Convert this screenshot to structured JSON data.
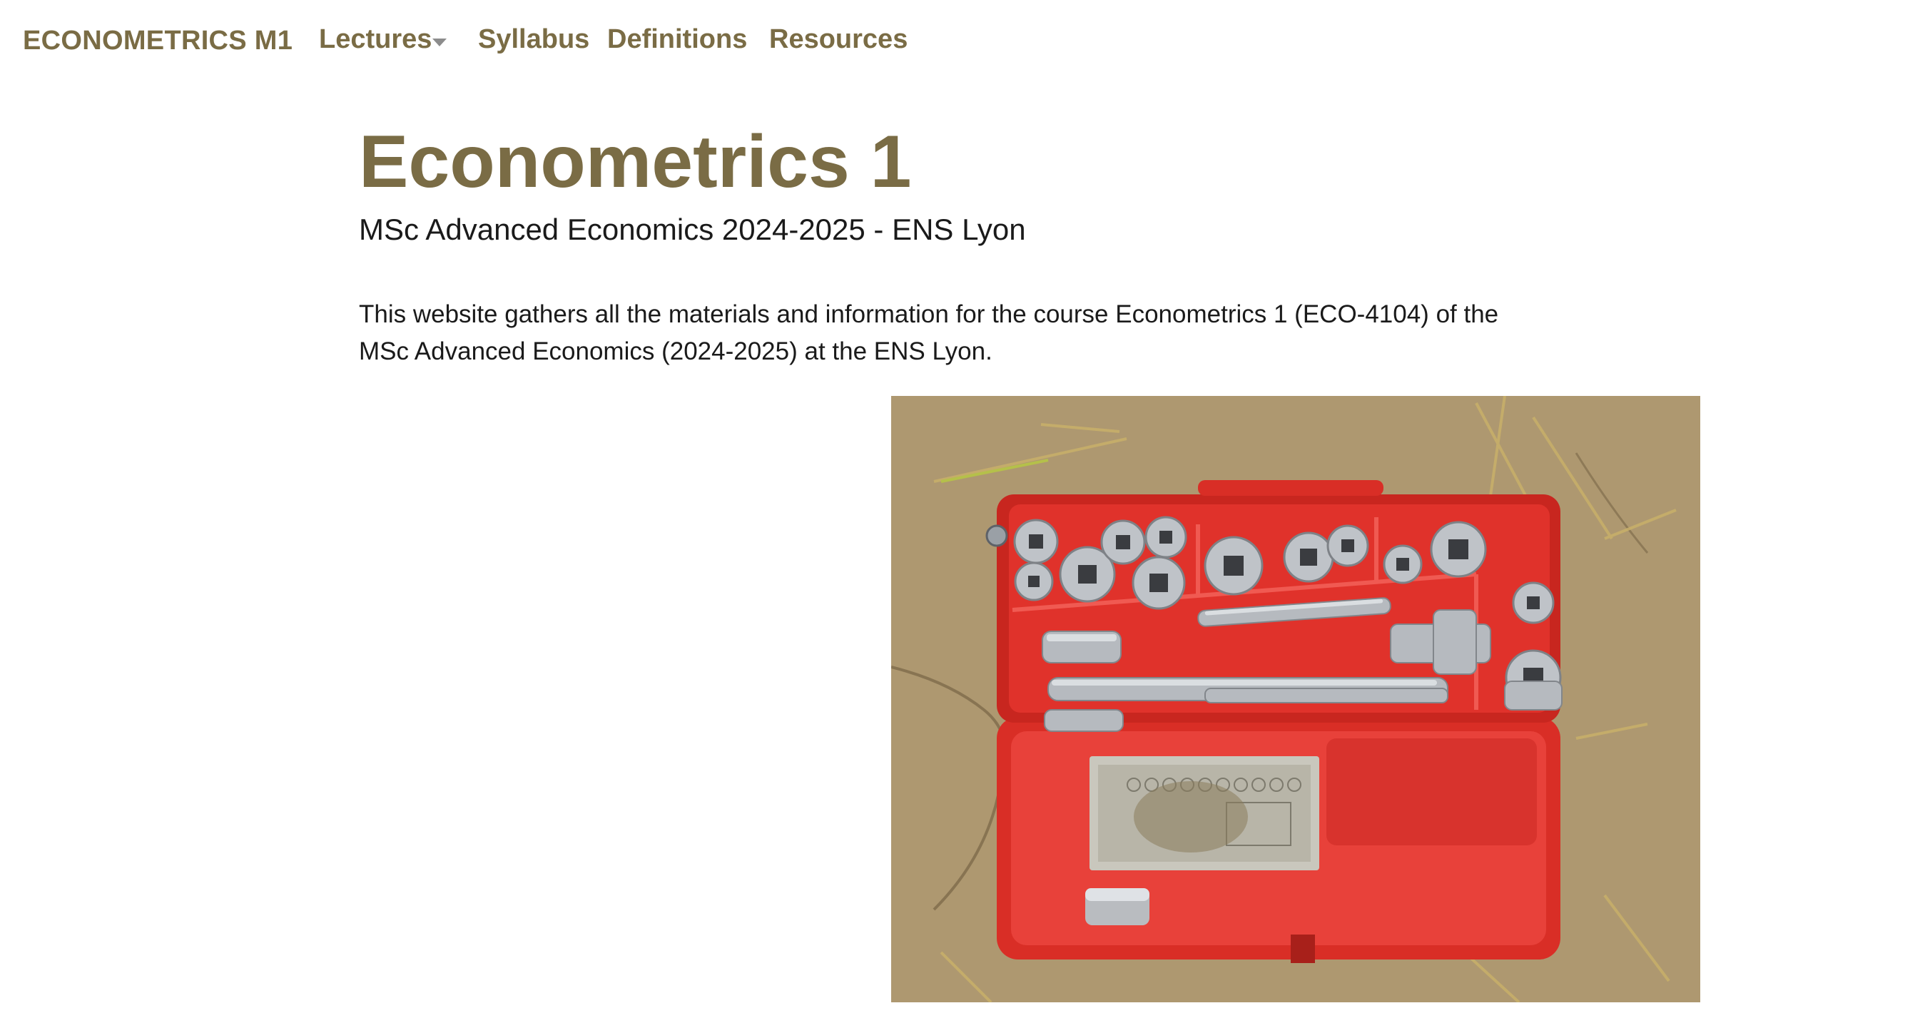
{
  "navbar": {
    "brand": "ECONOMETRICS M1",
    "items": [
      {
        "label": "Lectures",
        "has_dropdown": true
      },
      {
        "label": "Syllabus"
      },
      {
        "label": "Definitions"
      },
      {
        "label": "Resources"
      }
    ]
  },
  "main": {
    "title": "Econometrics 1",
    "subtitle": "MSc Advanced Economics 2024-2025 - ENS Lyon",
    "intro": "This website gathers all the materials and information for the course Econometrics 1 (ECO-4104) of the MSc Advanced Economics (2024-2025) at the ENS Lyon."
  },
  "colors": {
    "accent": "#7a6c45",
    "text": "#1a1a1a",
    "caret": "#8c8c8c",
    "toolbox_red": "#e0322b",
    "ground": "#b39d75"
  },
  "icons": {
    "dropdown": "chevron-down-icon"
  }
}
